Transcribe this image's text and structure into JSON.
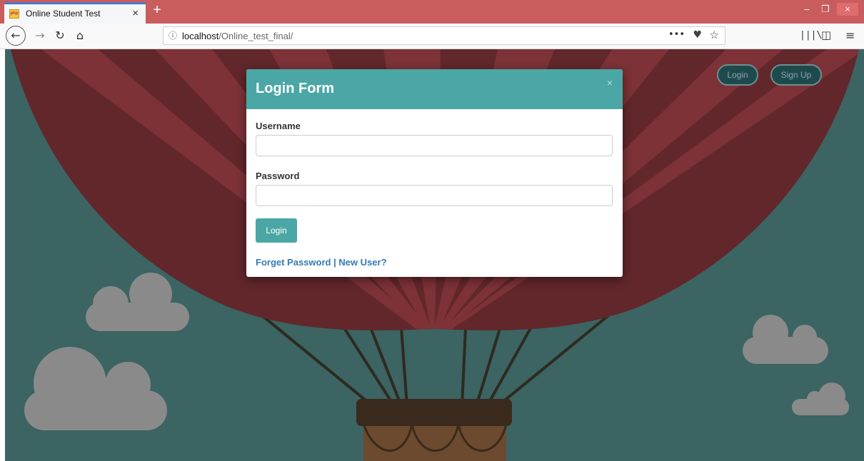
{
  "browser": {
    "tab_title": "Online Student Test",
    "tab_close": "×",
    "new_tab": "+",
    "url_host": "localhost",
    "url_path": "/Online_test_final/",
    "url_more": "•••",
    "win_min": "–",
    "win_max": "❐",
    "win_close": "×"
  },
  "page": {
    "nav": {
      "login_label": "Login",
      "signup_label": "Sign Up"
    },
    "modal": {
      "title": "Login Form",
      "close": "×",
      "username_label": "Username",
      "username_value": "",
      "password_label": "Password",
      "password_value": "",
      "login_button": "Login",
      "forget_password_link": "Forget Password",
      "separator": " | ",
      "new_user_link": "New User?"
    }
  },
  "colors": {
    "tab_bar": "#c95c5c",
    "sky": "#3b6462",
    "balloon_dark": "#62272b",
    "balloon_light": "#7c3237",
    "modal_header": "#4ba7a5",
    "link": "#337ab7",
    "cloud": "#8a8a8a"
  }
}
